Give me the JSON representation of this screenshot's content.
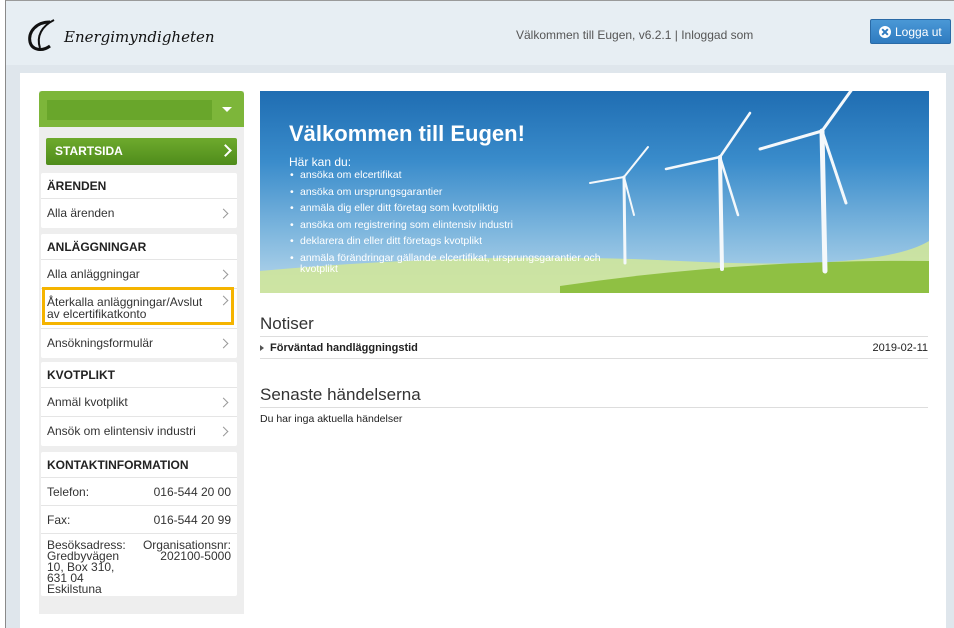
{
  "header": {
    "logo_text": "Energimyndigheten",
    "welcome_text": "Välkommen till Eugen, v6.2.1 | Inloggad som",
    "logout_label": "Logga ut"
  },
  "sidebar": {
    "start_label": "STARTSIDA",
    "sections": {
      "arenden": {
        "title": "ÄRENDEN",
        "items": [
          "Alla ärenden"
        ]
      },
      "anlaggningar": {
        "title": "ANLÄGGNINGAR",
        "items": [
          "Alla anläggningar",
          "Återkalla anläggningar/Avslut av elcertifikatkonto",
          "Ansökningsformulär"
        ]
      },
      "kvotplikt": {
        "title": "KVOTPLIKT",
        "items": [
          "Anmäl kvotplikt",
          "Ansök om elintensiv industri"
        ]
      },
      "kontakt": {
        "title": "KONTAKTINFORMATION",
        "phone_label": "Telefon:",
        "phone": "016-544 20 00",
        "fax_label": "Fax:",
        "fax": "016-544 20 99",
        "visit_label": "Besöksadress:",
        "visit_address": "Gredbyvägen 10, Box 310, 631 04 Eskilstuna",
        "org_label": "Organisationsnr:",
        "org_number": "202100-5000"
      }
    }
  },
  "banner": {
    "title": "Välkommen till Eugen!",
    "subtitle": "Här kan du:",
    "items": [
      "ansöka om elcertifikat",
      "ansöka om ursprungsgarantier",
      "anmäla dig eller ditt företag som kvotpliktig",
      "ansöka om registrering som elintensiv industri",
      "deklarera din eller ditt företags kvotplikt",
      "anmäla förändringar gällande elcertifikat, ursprungsgarantier och kvotplikt"
    ]
  },
  "notices": {
    "title": "Notiser",
    "items": [
      {
        "title": "Förväntad handläggningstid",
        "date": "2019-02-11"
      }
    ]
  },
  "events": {
    "title": "Senaste händelserna",
    "empty_text": "Du har inga aktuella händelser"
  },
  "colors": {
    "accent_green": "#6eaa2d",
    "highlight": "#f5b400",
    "logout_blue": "#3a88cc"
  }
}
